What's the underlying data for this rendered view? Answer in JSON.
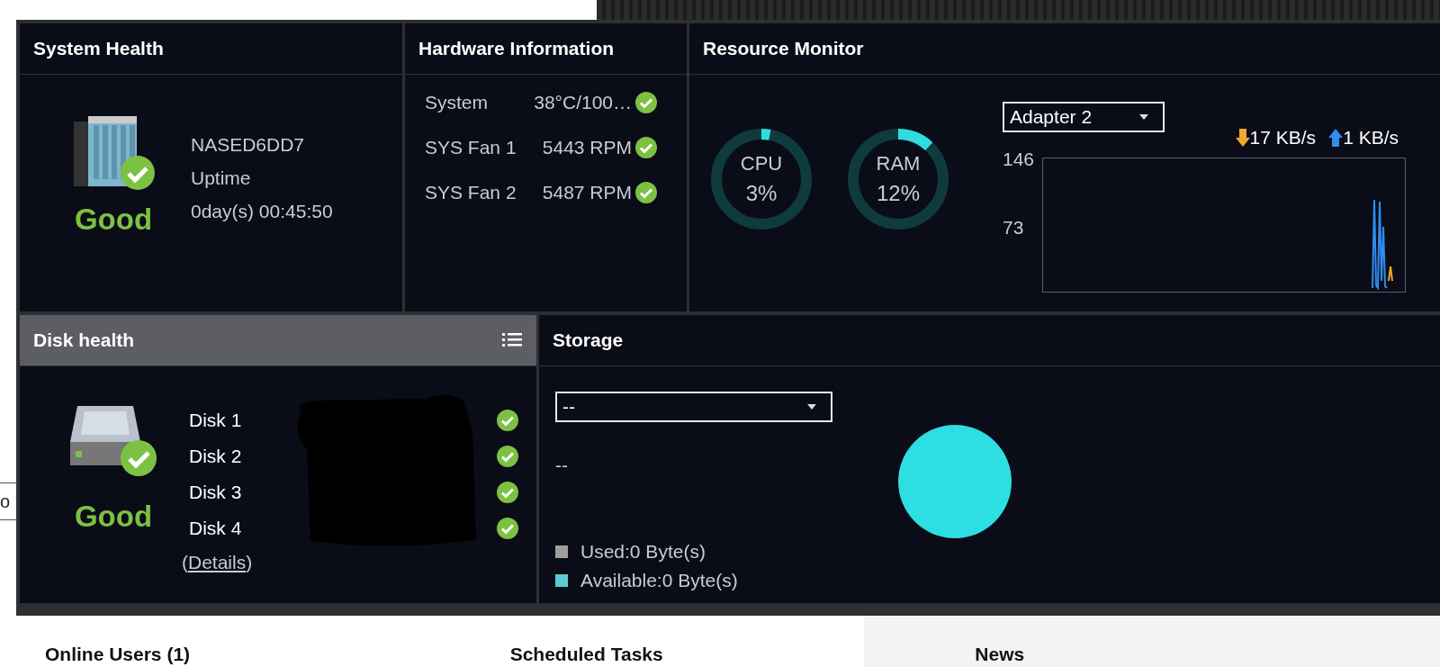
{
  "edge_field": {
    "value": "o"
  },
  "system_health": {
    "title": "System Health",
    "device_name": "NASED6DD7",
    "uptime_label": "Uptime",
    "uptime": "0day(s) 00:45:50",
    "status": "Good",
    "healthy": true
  },
  "hardware_information": {
    "title": "Hardware Information",
    "rows": [
      {
        "label": "System",
        "value": "38°C/100…",
        "ok": true
      },
      {
        "label": "SYS Fan 1",
        "value": "5443 RPM",
        "ok": true
      },
      {
        "label": "SYS Fan 2",
        "value": "5487 RPM",
        "ok": true
      }
    ]
  },
  "resource_monitor": {
    "title": "Resource Monitor",
    "gauges": [
      {
        "label": "CPU",
        "reading": "3%",
        "level": 0.03
      },
      {
        "label": "RAM",
        "reading": "12%",
        "level": 0.12
      }
    ],
    "adapter": {
      "value": "Adapter 2"
    },
    "download": "17 KB/s",
    "upload": "1 KB/s",
    "y_ticks": [
      "146",
      "73"
    ]
  },
  "disk_health": {
    "title": "Disk health",
    "status": "Good",
    "healthy": true,
    "disks": [
      {
        "label": "Disk 1",
        "ok": true
      },
      {
        "label": "Disk 2",
        "ok": true
      },
      {
        "label": "Disk 3",
        "ok": true
      },
      {
        "label": "Disk 4",
        "ok": true
      }
    ],
    "details_link": {
      "open": "(",
      "label": "Details",
      "close": ")"
    }
  },
  "storage": {
    "title": "Storage",
    "volume": {
      "value": "--"
    },
    "summary": "--",
    "legend": [
      {
        "label": "Used:0 Byte(s)",
        "color": "#9e9e9e"
      },
      {
        "label": "Available:0 Byte(s)",
        "color": "#5ccbd3"
      }
    ]
  },
  "footer": {
    "sections": [
      "Online Users (1)",
      "Scheduled Tasks",
      "News"
    ]
  }
}
